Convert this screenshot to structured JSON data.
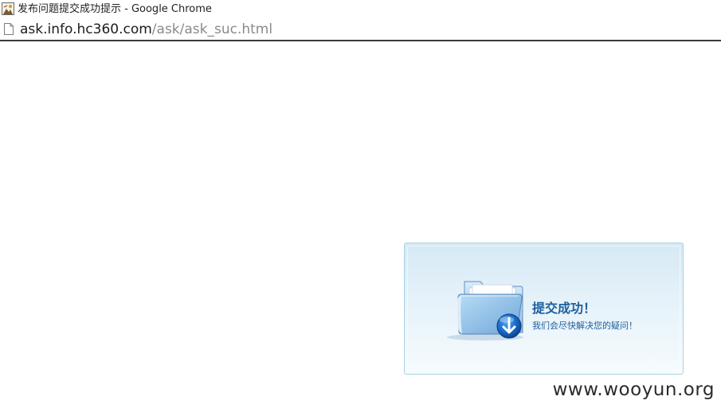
{
  "window": {
    "title": "发布问题提交成功提示 - Google Chrome",
    "favicon": "site-favicon"
  },
  "address_bar": {
    "host": "ask.info.hc360.com",
    "path": "/ask/ask_suc.html",
    "icon": "page-icon"
  },
  "success_box": {
    "title": "提交成功！",
    "message": "我们会尽快解决您的疑问！",
    "icon": "folder-download-icon",
    "accent_color": "#1e5f9e",
    "border_color": "#a9d3e3"
  },
  "watermark": {
    "text": "www.wooyun.org"
  }
}
